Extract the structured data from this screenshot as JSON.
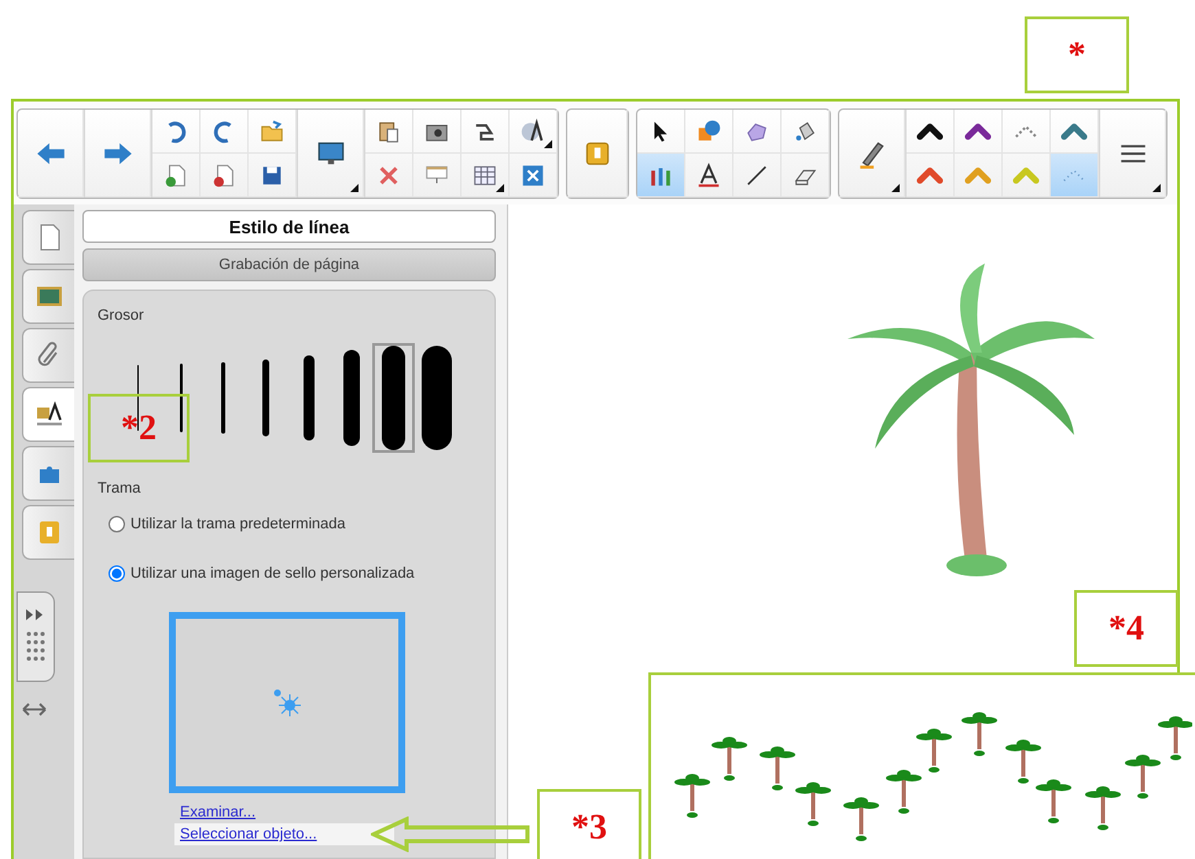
{
  "toolbar": [
    {
      "sections": [
        {
          "kind": "large",
          "buttons": [
            {
              "selected": false,
              "dropdown": false
            }
          ]
        },
        {
          "kind": "large",
          "buttons": [
            {
              "selected": false,
              "dropdown": false
            }
          ]
        },
        {
          "kind": "grid",
          "buttons": [
            {
              "selected": false,
              "dropdown": false
            },
            {
              "selected": false,
              "dropdown": false
            },
            {
              "selected": false,
              "dropdown": false
            },
            {
              "selected": false,
              "dropdown": false
            },
            {
              "selected": false,
              "dropdown": false
            },
            {
              "selected": false,
              "dropdown": false
            }
          ]
        },
        {
          "kind": "large",
          "buttons": [
            {
              "selected": false,
              "dropdown": true
            }
          ]
        },
        {
          "kind": "grid",
          "buttons": [
            {
              "selected": false,
              "dropdown": false
            },
            {
              "selected": false,
              "dropdown": false
            },
            {
              "selected": false,
              "dropdown": false
            },
            {
              "selected": false,
              "dropdown": true
            },
            {
              "selected": false,
              "dropdown": false
            },
            {
              "selected": false,
              "dropdown": false
            },
            {
              "selected": false,
              "dropdown": true
            },
            {
              "selected": false,
              "dropdown": false
            }
          ]
        }
      ]
    },
    {
      "sections": [
        {
          "kind": "large",
          "buttons": [
            {
              "selected": false,
              "dropdown": false
            }
          ]
        }
      ]
    },
    {
      "sections": [
        {
          "kind": "grid",
          "buttons": [
            {
              "selected": false,
              "dropdown": false
            },
            {
              "selected": false,
              "dropdown": false
            },
            {
              "selected": false,
              "dropdown": false
            },
            {
              "selected": false,
              "dropdown": false
            },
            {
              "selected": true,
              "dropdown": false
            },
            {
              "selected": false,
              "dropdown": false
            },
            {
              "selected": false,
              "dropdown": false
            },
            {
              "selected": false,
              "dropdown": false
            }
          ]
        }
      ]
    },
    {
      "sections": [
        {
          "kind": "large",
          "buttons": [
            {
              "selected": false,
              "dropdown": true
            }
          ]
        },
        {
          "kind": "grid",
          "buttons": [
            {
              "selected": false,
              "dropdown": false
            },
            {
              "selected": false,
              "dropdown": false
            },
            {
              "selected": false,
              "dropdown": false
            },
            {
              "selected": false,
              "dropdown": false
            },
            {
              "selected": false,
              "dropdown": false
            },
            {
              "selected": false,
              "dropdown": false
            },
            {
              "selected": false,
              "dropdown": false
            },
            {
              "selected": true,
              "dropdown": false
            }
          ]
        },
        {
          "kind": "large",
          "buttons": [
            {
              "selected": false,
              "dropdown": true
            }
          ]
        }
      ]
    }
  ],
  "side_tabs": [
    {
      "selected": false
    },
    {
      "selected": false
    },
    {
      "selected": false
    },
    {
      "selected": true
    },
    {
      "selected": false
    },
    {
      "selected": false
    }
  ],
  "panel": {
    "header": "Estilo de línea",
    "subheader": "Grabación de página",
    "thickness": {
      "label": "Grosor",
      "options": [
        {
          "selected": false
        },
        {
          "selected": false
        },
        {
          "selected": false
        },
        {
          "selected": false
        },
        {
          "selected": false
        },
        {
          "selected": false
        },
        {
          "selected": true
        },
        {
          "selected": false
        }
      ]
    },
    "pattern": {
      "label": "Trama",
      "options": [
        {
          "label": "Utilizar la trama predeterminada",
          "selected": false
        },
        {
          "label": "Utilizar una imagen de sello personalizada",
          "selected": true
        }
      ]
    },
    "links": [
      {
        "label": "Examinar...",
        "selected": false
      },
      {
        "label": "Seleccionar objeto...",
        "selected": true
      }
    ]
  },
  "annotations": [
    {
      "label": "*"
    },
    {
      "label": "*2"
    },
    {
      "label": "*3"
    },
    {
      "label": "*4"
    }
  ]
}
